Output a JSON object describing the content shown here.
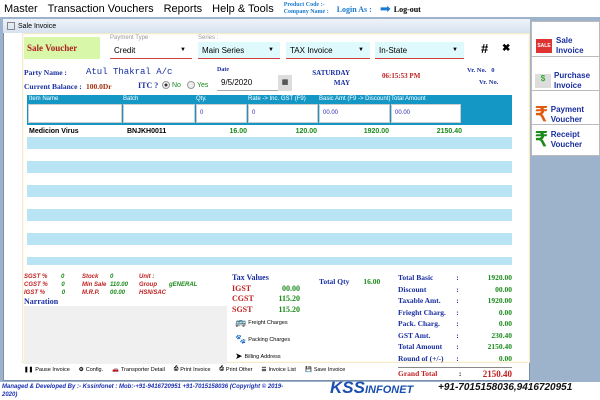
{
  "menu": {
    "items": [
      "Master",
      "Transaction Vouchers",
      "Reports",
      "Help & Tools"
    ],
    "product_code": "Product Code :-",
    "company_name": "Company Name :",
    "login_as": "Login As :",
    "logout": "Log-out"
  },
  "window": {
    "title": "Sale Invoice"
  },
  "form": {
    "voucher_title": "Sale Voucher",
    "payment_type_label": "Payment Type",
    "payment_type": "Credit",
    "series_label": "Series :",
    "series": "Main Series",
    "invoice_type": "TAX Invoice",
    "state": "In-State",
    "hash": "#",
    "close": "✖",
    "party_label": "Party Name :",
    "party": "Atul Thakral A/c",
    "balance_label": "Current Balance :",
    "balance": "100.0Dr",
    "itc_label": "ITC ?",
    "itc_no": "No",
    "itc_yes": "Yes",
    "date_label": "Date",
    "date": "9/5/2020",
    "day": "SATURDAY",
    "month": "MAY",
    "time": "06:15:53 PM",
    "vr_no_label": "Vr. No.",
    "vr_no": "0",
    "vr_no_label2": "Vr. No."
  },
  "grid": {
    "headers": [
      "Item Name",
      "Batch",
      "Qty.",
      "Rate -> Inc. GST (F9)",
      "Basic Amt (F9 -> Discount)",
      "Total Amount"
    ],
    "inputs": [
      "",
      "",
      "0",
      "0",
      "00.00",
      "00.00"
    ],
    "rows": [
      {
        "item": "Medicion Virus",
        "batch": "BNJKH0011",
        "qty": "16.00",
        "rate": "120.00",
        "basic": "1920.00",
        "total": "2150.40"
      }
    ]
  },
  "info": {
    "sgst_l": "SGST %",
    "sgst": "0",
    "cgst_l": "CGST %",
    "cgst": "0",
    "igst_l": "IGST %",
    "igst": "0",
    "stock_l": "Stock",
    "stock": "0",
    "minsale_l": "Min Sale",
    "minsale": "110.00",
    "mrp_l": "M.R.P.",
    "mrp": "00.00",
    "unit_l": "Unit :",
    "group_l": "Group",
    "group": "gENERAL",
    "hsn_l": "HSN/SAC",
    "narration": "Narration"
  },
  "tax": {
    "title": "Tax Values",
    "igst_l": "IGST",
    "igst": "00.00",
    "cgst_l": "CGST",
    "cgst": "115.20",
    "sgst_l": "SGST",
    "sgst": "115.20",
    "total_qty_l": "Total Qty",
    "total_qty": "16.00"
  },
  "links": [
    "Freight Charges",
    "Packing Charges",
    "Billing Address"
  ],
  "totals": [
    {
      "l": "Total Basic",
      "v": "1920.00"
    },
    {
      "l": "Discount",
      "v": "00.00"
    },
    {
      "l": "Taxable Amt.",
      "v": "1920.00"
    },
    {
      "l": "Frieght Charg.",
      "v": "0.00"
    },
    {
      "l": "Pack. Charg.",
      "v": "0.00"
    },
    {
      "l": "GST Amt.",
      "v": "230.40"
    },
    {
      "l": "Total Amount",
      "v": "2150.40"
    },
    {
      "l": "Round of (+/-)",
      "v": "0.00"
    }
  ],
  "grand": {
    "l": "Grand Total",
    "v": "2150.40"
  },
  "bottom": [
    "Pause Invoice",
    "Config.",
    "Transporter Detail",
    "Print Invoice",
    "Print Other",
    "Invoice List",
    "Save Invoice"
  ],
  "side": [
    "Sale Invoice",
    "Purchase Invoice",
    "Payment Voucher",
    "Receipt Voucher"
  ],
  "footer": {
    "text": "Managed & Developed By :- Kssinfonet : Mob:-+91-9416720951 +91-7015158036 (Copyright © 2019-2020)",
    "logo": "KSS INFONET",
    "phone": "+91-7015158036,9416720951"
  }
}
